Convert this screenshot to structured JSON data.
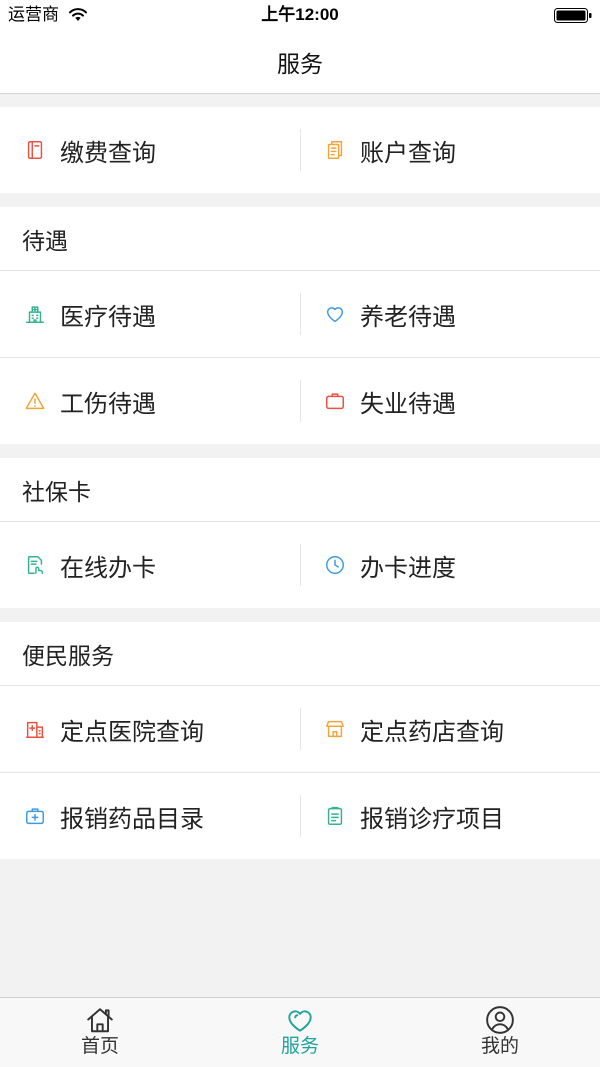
{
  "status_bar": {
    "carrier": "运营商",
    "time": "上午12:00",
    "wifi_icon": "wifi-icon",
    "battery_icon": "battery-icon"
  },
  "nav": {
    "title": "服务"
  },
  "quick_access": {
    "items": [
      {
        "label": "缴费查询",
        "icon": "bill-book-icon",
        "color": "#e8523f"
      },
      {
        "label": "账户查询",
        "icon": "account-document-icon",
        "color": "#f0a43a"
      }
    ]
  },
  "sections": [
    {
      "title": "待遇",
      "rows": [
        [
          {
            "label": "医疗待遇",
            "icon": "hospital-building-icon",
            "color": "#35b292"
          },
          {
            "label": "养老待遇",
            "icon": "heart-icon",
            "color": "#3d9be0"
          }
        ],
        [
          {
            "label": "工伤待遇",
            "icon": "warning-icon",
            "color": "#f0a43a"
          },
          {
            "label": "失业待遇",
            "icon": "briefcase-icon",
            "color": "#e8523f"
          }
        ]
      ]
    },
    {
      "title": "社保卡",
      "rows": [
        [
          {
            "label": "在线办卡",
            "icon": "card-application-icon",
            "color": "#35b292"
          },
          {
            "label": "办卡进度",
            "icon": "clock-icon",
            "color": "#3d9be0"
          }
        ]
      ]
    },
    {
      "title": "便民服务",
      "rows": [
        [
          {
            "label": "定点医院查询",
            "icon": "hospital-icon",
            "color": "#e8523f"
          },
          {
            "label": "定点药店查询",
            "icon": "store-icon",
            "color": "#f0a43a"
          }
        ],
        [
          {
            "label": "报销药品目录",
            "icon": "medical-kit-icon",
            "color": "#3d9be0"
          },
          {
            "label": "报销诊疗项目",
            "icon": "clipboard-icon",
            "color": "#35b292"
          }
        ]
      ]
    }
  ],
  "tab_bar": {
    "items": [
      {
        "label": "首页",
        "icon": "home-icon",
        "active": false
      },
      {
        "label": "服务",
        "icon": "heart-outline-icon",
        "active": true
      },
      {
        "label": "我的",
        "icon": "user-circle-icon",
        "active": false
      }
    ]
  },
  "colors": {
    "background": "#f2f2f2",
    "surface": "#ffffff",
    "text": "#222222",
    "divider": "#e6e6e6",
    "tab_active": "#1fa39a",
    "tab_inactive": "#333333"
  }
}
